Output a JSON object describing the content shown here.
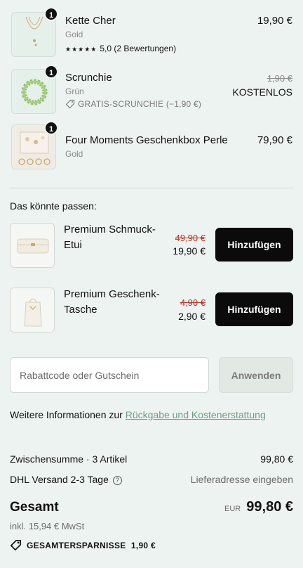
{
  "cart_items": [
    {
      "qty": "1",
      "name": "Kette Cher",
      "variant": "Gold",
      "price": "19,90 €",
      "rating_stars": "★★★★★",
      "rating_text": "5,0 (2 Bewertungen)",
      "image_icon": "necklace-icon"
    },
    {
      "qty": "1",
      "name": "Scrunchie",
      "variant": "Grün",
      "old_price": "1,90 €",
      "price": "KOSTENLOS",
      "discount": "GRATIS-SCRUNCHIE (−1,90 €)",
      "image_icon": "scrunchie-icon"
    },
    {
      "qty": "1",
      "name": "Four Moments Geschenkbox Perle",
      "variant": "Gold",
      "price": "79,90 €",
      "image_icon": "gift-box-icon"
    }
  ],
  "upsell": {
    "title": "Das könnte passen:",
    "items": [
      {
        "name": "Premium Schmuck- Etui",
        "old_price": "49,90 €",
        "price": "19,90 €",
        "button": "Hinzufügen",
        "image_icon": "jewelry-case-icon"
      },
      {
        "name": "Premium Geschenk- Tasche",
        "old_price": "4,90 €",
        "price": "2,90 €",
        "button": "Hinzufügen",
        "image_icon": "gift-bag-icon"
      }
    ]
  },
  "discount_code": {
    "placeholder": "Rabattcode oder Gutschein",
    "value": "",
    "button": "Anwenden"
  },
  "info": {
    "text": "Weitere Informationen zur ",
    "link": "Rückgabe und Kostenerstattung"
  },
  "summary": {
    "subtotal_label": "Zwischensumme · 3 Artikel",
    "subtotal_value": "99,80 €",
    "shipping_label": "DHL Versand 2-3 Tage",
    "shipping_value": "Lieferadresse eingeben",
    "total_label": "Gesamt",
    "currency": "EUR",
    "total_value": "99,80 €",
    "tax": "inkl. 15,94 € MwSt",
    "savings": "GESAMTERSPARNISSE  1,90 €"
  },
  "colors": {
    "background": "#edf3f0",
    "button": "#0b0b0b",
    "strike_red": "#b5342a",
    "link": "#6f9d86"
  }
}
